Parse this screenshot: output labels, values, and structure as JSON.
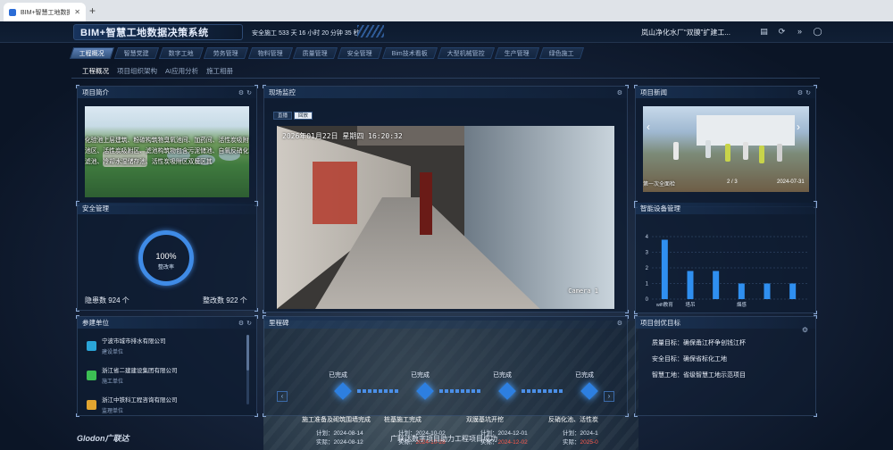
{
  "browser": {
    "tab_title": "BIM+智慧工地数据...",
    "new_tab": "+"
  },
  "header": {
    "title": "BIM+智慧工地数据决策系统",
    "safe_days": "安全施工 533 天 16 小时 20 分钟 35 秒",
    "project_name": "岚山净化水厂“双膜”扩建工...",
    "icons": [
      "doc-icon",
      "refresh-icon",
      "double-chevron-icon",
      "user-icon"
    ]
  },
  "nav": [
    "工程概况",
    "智慧党建",
    "数字工地",
    "劳务管理",
    "物料管理",
    "质量管理",
    "安全管理",
    "Bim技术看板",
    "大型机械管控",
    "生产管理",
    "绿色施工"
  ],
  "subnav": [
    "工程概况",
    "项目组织架构",
    "AI应用分析",
    "施工相册"
  ],
  "intro": {
    "title": "项目简介",
    "text": "化验池上层建筑、粉碳构筑物臭氧池间、加药间、活性炭吸附池区、活性炭吸附区、滤池构筑物包含污泥储池、自氧反硝化滤池、冷却水湿储存池、活性炭吸附区双膜区其"
  },
  "safety": {
    "title": "安全管理",
    "rate_value": "100%",
    "rate_label": "整改率",
    "hazards": "隐患数 924 个",
    "rectified": "整改数 922 个"
  },
  "units": {
    "title": "参建单位",
    "items": [
      {
        "name": "宁波市城市排水有限公司",
        "role": "建设单位",
        "color": "#2aa5d8"
      },
      {
        "name": "浙江省二建建设集团有限公司",
        "role": "施工单位",
        "color": "#3cbf54"
      },
      {
        "name": "浙江中铁科工程咨询有限公司",
        "role": "监理单位",
        "color": "#e0a430"
      }
    ]
  },
  "video": {
    "title": "现场监控",
    "tabs": [
      "直播",
      "回放"
    ],
    "timestamp": "2026年01月22日 星期四 16:20:32",
    "camera": "Camera 1"
  },
  "news": {
    "title": "项目新闻",
    "caption": "第一次全面检",
    "page": "2 / 3",
    "date": "2024-07-31"
  },
  "devices": {
    "title": "智能设备管理",
    "chart_data": {
      "type": "bar",
      "title": "",
      "categories": [
        "wifi教育",
        "塔吊",
        "",
        "烟感",
        "",
        ""
      ],
      "values": [
        3.8,
        1.8,
        1.8,
        1.0,
        1.0,
        1.0
      ],
      "ylim": [
        0,
        4
      ],
      "yticks": [
        0,
        1,
        2,
        3,
        4
      ],
      "xlabel": "",
      "ylabel": "",
      "grid": true,
      "color": "#2f8ff0"
    }
  },
  "milestones": {
    "title": "里程碑",
    "items": [
      {
        "status": "已完成",
        "name": "施工准备及砌筑围墙完成",
        "plan": "计划：2024-08-14",
        "actual_label": "实际：",
        "actual": "2024-08-12",
        "actual_late": false
      },
      {
        "status": "已完成",
        "name": "桩基施工完成",
        "plan": "计划：2024-10-02",
        "actual_label": "实际：",
        "actual": "2024-10-28",
        "actual_late": true
      },
      {
        "status": "已完成",
        "name": "双膜基坑开挖",
        "plan": "计划：2024-12-01",
        "actual_label": "实际：",
        "actual": "2024-12-02",
        "actual_late": true
      },
      {
        "status": "已完成",
        "name": "反硝化池、活性炭",
        "plan": "计划：2024-1",
        "actual_label": "实际：",
        "actual": "2025-0",
        "actual_late": true
      }
    ]
  },
  "goals": {
    "title": "项目创优目标",
    "items": [
      "质量目标：确保甬江杯争创钱江杯",
      "安全目标：确保省标化工地",
      "智慧工地：省级智慧工地示范项目"
    ]
  },
  "footer": {
    "logo": "Glodon广联达",
    "slogan": "广联达数字项目助力工程项目成功"
  }
}
